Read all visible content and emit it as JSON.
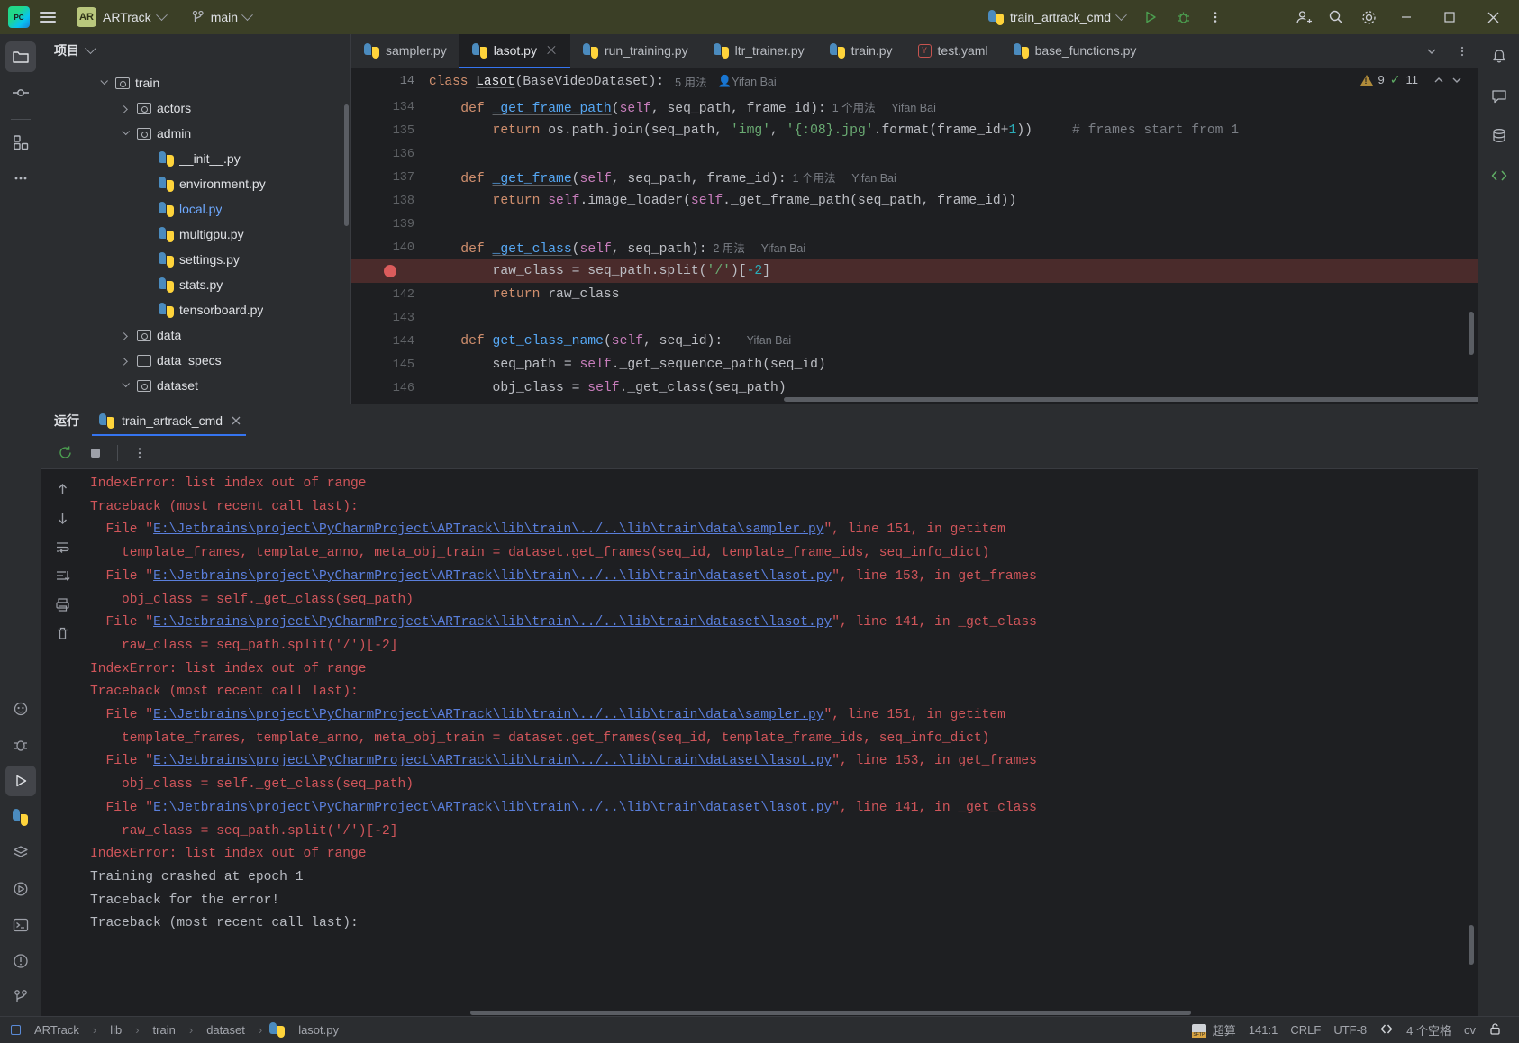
{
  "titlebar": {
    "logo": "pycharm-logo",
    "menu_icon": "hamburger-menu-icon",
    "project_badge": "AR",
    "project_name": "ARTrack",
    "branch_icon": "git-branch-icon",
    "branch_name": "main",
    "run_config": "train_artrack_cmd",
    "run_icon": "run-icon",
    "debug_icon": "debug-icon",
    "more_icon": "more-vertical-icon",
    "account_icon": "add-user-icon",
    "search_icon": "search-icon",
    "settings_icon": "gear-icon",
    "minimize": "–",
    "maximize": "□",
    "close": "✕"
  },
  "left_rail": [
    {
      "name": "project-tool-icon",
      "active": true
    },
    {
      "name": "commit-tool-icon",
      "active": false
    },
    {
      "name": "structure-tool-icon",
      "active": false
    },
    {
      "name": "more-tool-icon",
      "active": false
    }
  ],
  "left_rail_bottom": [
    {
      "name": "ai-assistant-icon"
    },
    {
      "name": "debug-tool-icon"
    },
    {
      "name": "run-tool-icon",
      "active": true
    },
    {
      "name": "python-packages-icon"
    },
    {
      "name": "services-icon"
    },
    {
      "name": "run-anything-icon"
    },
    {
      "name": "terminal-icon"
    },
    {
      "name": "problems-icon"
    },
    {
      "name": "version-control-icon"
    }
  ],
  "right_rail": [
    {
      "name": "notifications-icon"
    },
    {
      "name": "ai-chat-icon"
    },
    {
      "name": "database-icon"
    },
    {
      "name": "code-with-me-icon"
    }
  ],
  "project_panel": {
    "title": "项目",
    "chevron": "chevron-down-icon",
    "tree": [
      {
        "label": "train",
        "indent": 2,
        "type": "folder-src",
        "state": "open",
        "modified": false
      },
      {
        "label": "actors",
        "indent": 3,
        "type": "folder-src",
        "state": "closed",
        "modified": false
      },
      {
        "label": "admin",
        "indent": 3,
        "type": "folder-src",
        "state": "open",
        "modified": false
      },
      {
        "label": "__init__.py",
        "indent": 4,
        "type": "python",
        "state": "leaf",
        "modified": false
      },
      {
        "label": "environment.py",
        "indent": 4,
        "type": "python",
        "state": "leaf",
        "modified": false
      },
      {
        "label": "local.py",
        "indent": 4,
        "type": "python",
        "state": "leaf",
        "modified": true
      },
      {
        "label": "multigpu.py",
        "indent": 4,
        "type": "python",
        "state": "leaf",
        "modified": false
      },
      {
        "label": "settings.py",
        "indent": 4,
        "type": "python",
        "state": "leaf",
        "modified": false
      },
      {
        "label": "stats.py",
        "indent": 4,
        "type": "python",
        "state": "leaf",
        "modified": false
      },
      {
        "label": "tensorboard.py",
        "indent": 4,
        "type": "python",
        "state": "leaf",
        "modified": false
      },
      {
        "label": "data",
        "indent": 3,
        "type": "folder-src",
        "state": "closed",
        "modified": false
      },
      {
        "label": "data_specs",
        "indent": 3,
        "type": "folder",
        "state": "closed",
        "modified": false
      },
      {
        "label": "dataset",
        "indent": 3,
        "type": "folder-src",
        "state": "open",
        "modified": false
      }
    ]
  },
  "editor": {
    "tabs": [
      {
        "label": "sampler.py",
        "icon": "python-file-icon",
        "active": false,
        "closable": false
      },
      {
        "label": "lasot.py",
        "icon": "python-file-icon",
        "active": true,
        "closable": true
      },
      {
        "label": "run_training.py",
        "icon": "python-file-icon",
        "active": false,
        "closable": false
      },
      {
        "label": "ltr_trainer.py",
        "icon": "python-file-icon",
        "active": false,
        "closable": false
      },
      {
        "label": "train.py",
        "icon": "python-file-icon",
        "active": false,
        "closable": false
      },
      {
        "label": "test.yaml",
        "icon": "yaml-file-icon",
        "active": false,
        "closable": false
      },
      {
        "label": "base_functions.py",
        "icon": "python-file-icon",
        "active": false,
        "closable": false
      }
    ],
    "tab_overflow_icon": "chevron-down-icon",
    "tab_more_icon": "more-vertical-icon",
    "sticky_header": {
      "line_no": "14",
      "keyword": "class",
      "class_name": "Lasot",
      "signature": "(BaseVideoDataset):",
      "usages": "5 用法",
      "author": "Yifan Bai",
      "author_icon": "person-icon"
    },
    "inspection": {
      "warning_icon": "warning-triangle-icon",
      "warning_count": "9",
      "check_icon": "checkmark-icon",
      "check_count": "11",
      "prev_icon": "chevron-up-icon",
      "next_icon": "chevron-down-icon"
    },
    "lines": [
      {
        "no": "134",
        "breakpoint": false,
        "highlight": false,
        "parts": [
          {
            "t": "    ",
            "c": "def"
          },
          {
            "t": "def ",
            "c": "kw"
          },
          {
            "t": "_get_frame_path",
            "c": "fn squig underl"
          },
          {
            "t": "(",
            "c": "def"
          },
          {
            "t": "self",
            "c": "self"
          },
          {
            "t": ", seq_path, frame_id):",
            "c": "def"
          },
          {
            "t": "  1 个用法",
            "c": "hint"
          },
          {
            "t": "  ",
            "c": "def"
          },
          {
            "t": "Yifan Bai",
            "c": "author"
          }
        ]
      },
      {
        "no": "135",
        "breakpoint": false,
        "highlight": false,
        "parts": [
          {
            "t": "        ",
            "c": "def"
          },
          {
            "t": "return",
            "c": "kw"
          },
          {
            "t": " os.path.join(seq_path, ",
            "c": "def"
          },
          {
            "t": "'img'",
            "c": "str"
          },
          {
            "t": ", ",
            "c": "def"
          },
          {
            "t": "'{:08}.jpg'",
            "c": "str"
          },
          {
            "t": ".format(frame_id+",
            "c": "def"
          },
          {
            "t": "1",
            "c": "num"
          },
          {
            "t": "))",
            "c": "def"
          },
          {
            "t": "     # frames start from 1",
            "c": "cmt"
          }
        ]
      },
      {
        "no": "136",
        "breakpoint": false,
        "highlight": false,
        "parts": []
      },
      {
        "no": "137",
        "breakpoint": false,
        "highlight": false,
        "parts": [
          {
            "t": "    ",
            "c": "def"
          },
          {
            "t": "def ",
            "c": "kw"
          },
          {
            "t": "_get_frame",
            "c": "fn underl"
          },
          {
            "t": "(",
            "c": "def"
          },
          {
            "t": "self",
            "c": "self"
          },
          {
            "t": ", seq_path, frame_id):",
            "c": "def"
          },
          {
            "t": "  1 个用法",
            "c": "hint"
          },
          {
            "t": "  ",
            "c": "def"
          },
          {
            "t": "Yifan Bai",
            "c": "author"
          }
        ]
      },
      {
        "no": "138",
        "breakpoint": false,
        "highlight": false,
        "parts": [
          {
            "t": "        ",
            "c": "def"
          },
          {
            "t": "return",
            "c": "kw"
          },
          {
            "t": " ",
            "c": "def"
          },
          {
            "t": "self",
            "c": "self"
          },
          {
            "t": ".image_loader(",
            "c": "def"
          },
          {
            "t": "self",
            "c": "self"
          },
          {
            "t": "._get_frame_path(seq_path, frame_id))",
            "c": "def"
          }
        ]
      },
      {
        "no": "139",
        "breakpoint": false,
        "highlight": false,
        "parts": []
      },
      {
        "no": "140",
        "breakpoint": false,
        "highlight": false,
        "parts": [
          {
            "t": "    ",
            "c": "def"
          },
          {
            "t": "def ",
            "c": "kw"
          },
          {
            "t": "_get_class",
            "c": "fn squig underl"
          },
          {
            "t": "(",
            "c": "def"
          },
          {
            "t": "self",
            "c": "self"
          },
          {
            "t": ", seq_path):",
            "c": "def"
          },
          {
            "t": "  2 用法",
            "c": "hint"
          },
          {
            "t": "  ",
            "c": "def"
          },
          {
            "t": "Yifan Bai",
            "c": "author"
          }
        ]
      },
      {
        "no": "141",
        "breakpoint": true,
        "highlight": true,
        "parts": [
          {
            "t": "        raw_class = seq_path.split(",
            "c": "def"
          },
          {
            "t": "'/'",
            "c": "str"
          },
          {
            "t": ")[",
            "c": "def"
          },
          {
            "t": "-2",
            "c": "num"
          },
          {
            "t": "]",
            "c": "def"
          }
        ]
      },
      {
        "no": "142",
        "breakpoint": false,
        "highlight": false,
        "parts": [
          {
            "t": "        ",
            "c": "def"
          },
          {
            "t": "return",
            "c": "kw"
          },
          {
            "t": " raw_class",
            "c": "def"
          }
        ]
      },
      {
        "no": "143",
        "breakpoint": false,
        "highlight": false,
        "parts": []
      },
      {
        "no": "144",
        "breakpoint": false,
        "highlight": false,
        "parts": [
          {
            "t": "    ",
            "c": "def"
          },
          {
            "t": "def ",
            "c": "kw"
          },
          {
            "t": "get_class_name",
            "c": "fn"
          },
          {
            "t": "(",
            "c": "def"
          },
          {
            "t": "self",
            "c": "self"
          },
          {
            "t": ", seq_id):",
            "c": "def"
          },
          {
            "t": "   ",
            "c": "def"
          },
          {
            "t": "Yifan Bai",
            "c": "author"
          }
        ]
      },
      {
        "no": "145",
        "breakpoint": false,
        "highlight": false,
        "parts": [
          {
            "t": "        seq_path = ",
            "c": "def"
          },
          {
            "t": "self",
            "c": "self"
          },
          {
            "t": "._get_sequence_path(seq_id)",
            "c": "def"
          }
        ]
      },
      {
        "no": "146",
        "breakpoint": false,
        "highlight": false,
        "parts": [
          {
            "t": "        obj_class = ",
            "c": "def"
          },
          {
            "t": "self",
            "c": "self"
          },
          {
            "t": "._get_class(seq_path)",
            "c": "def"
          }
        ]
      }
    ]
  },
  "run_panel": {
    "label": "运行",
    "tab_label": "train_artrack_cmd",
    "tab_icon": "python-file-icon",
    "tab_close_icon": "close-icon",
    "toolbar": [
      {
        "name": "rerun-icon"
      },
      {
        "name": "stop-icon"
      },
      {
        "name": "more-vertical-icon"
      }
    ],
    "side_icons": [
      {
        "name": "scroll-up-icon"
      },
      {
        "name": "scroll-down-icon"
      },
      {
        "name": "soft-wrap-icon"
      },
      {
        "name": "scroll-to-end-icon"
      },
      {
        "name": "print-icon"
      },
      {
        "name": "clear-all-icon"
      }
    ],
    "console": [
      {
        "type": "err",
        "text": "IndexError: list index out of range"
      },
      {
        "type": "err",
        "text": "Traceback (most recent call last):"
      },
      {
        "type": "link",
        "prefix": "  File \"",
        "link": "E:\\Jetbrains\\project\\PyCharmProject\\ARTrack\\lib\\train\\../..\\lib\\train\\data\\sampler.py",
        "suffix": "\", line 151, in getitem"
      },
      {
        "type": "err",
        "text": "    template_frames, template_anno, meta_obj_train = dataset.get_frames(seq_id, template_frame_ids, seq_info_dict)"
      },
      {
        "type": "link",
        "prefix": "  File \"",
        "link": "E:\\Jetbrains\\project\\PyCharmProject\\ARTrack\\lib\\train\\../..\\lib\\train\\dataset\\lasot.py",
        "suffix": "\", line 153, in get_frames"
      },
      {
        "type": "err",
        "text": "    obj_class = self._get_class(seq_path)"
      },
      {
        "type": "link",
        "prefix": "  File \"",
        "link": "E:\\Jetbrains\\project\\PyCharmProject\\ARTrack\\lib\\train\\../..\\lib\\train\\dataset\\lasot.py",
        "suffix": "\", line 141, in _get_class"
      },
      {
        "type": "err",
        "text": "    raw_class = seq_path.split('/')[-2]"
      },
      {
        "type": "err",
        "text": "IndexError: list index out of range"
      },
      {
        "type": "err",
        "text": "Traceback (most recent call last):"
      },
      {
        "type": "link",
        "prefix": "  File \"",
        "link": "E:\\Jetbrains\\project\\PyCharmProject\\ARTrack\\lib\\train\\../..\\lib\\train\\data\\sampler.py",
        "suffix": "\", line 151, in getitem"
      },
      {
        "type": "err",
        "text": "    template_frames, template_anno, meta_obj_train = dataset.get_frames(seq_id, template_frame_ids, seq_info_dict)"
      },
      {
        "type": "link",
        "prefix": "  File \"",
        "link": "E:\\Jetbrains\\project\\PyCharmProject\\ARTrack\\lib\\train\\../..\\lib\\train\\dataset\\lasot.py",
        "suffix": "\", line 153, in get_frames"
      },
      {
        "type": "err",
        "text": "    obj_class = self._get_class(seq_path)"
      },
      {
        "type": "link",
        "prefix": "  File \"",
        "link": "E:\\Jetbrains\\project\\PyCharmProject\\ARTrack\\lib\\train\\../..\\lib\\train\\dataset\\lasot.py",
        "suffix": "\", line 141, in _get_class"
      },
      {
        "type": "err",
        "text": "    raw_class = seq_path.split('/')[-2]"
      },
      {
        "type": "err",
        "text": "IndexError: list index out of range"
      },
      {
        "type": "info",
        "text": "Training crashed at epoch 1"
      },
      {
        "type": "info",
        "text": "Traceback for the error!"
      },
      {
        "type": "info",
        "text": "Traceback (most recent call last):"
      }
    ]
  },
  "statusbar": {
    "breadcrumb": [
      "ARTrack",
      "lib",
      "train",
      "dataset",
      "lasot.py"
    ],
    "project_icon": "project-module-icon",
    "file_icon": "python-file-icon",
    "sftp_icon": "sftp-icon",
    "sftp_label": "超算",
    "caret": "141:1",
    "line_sep": "CRLF",
    "encoding": "UTF-8",
    "inspection_icon": "inspection-widget-icon",
    "indent": "4 个空格",
    "branch": "cv",
    "lock_icon": "lock-open-icon"
  }
}
